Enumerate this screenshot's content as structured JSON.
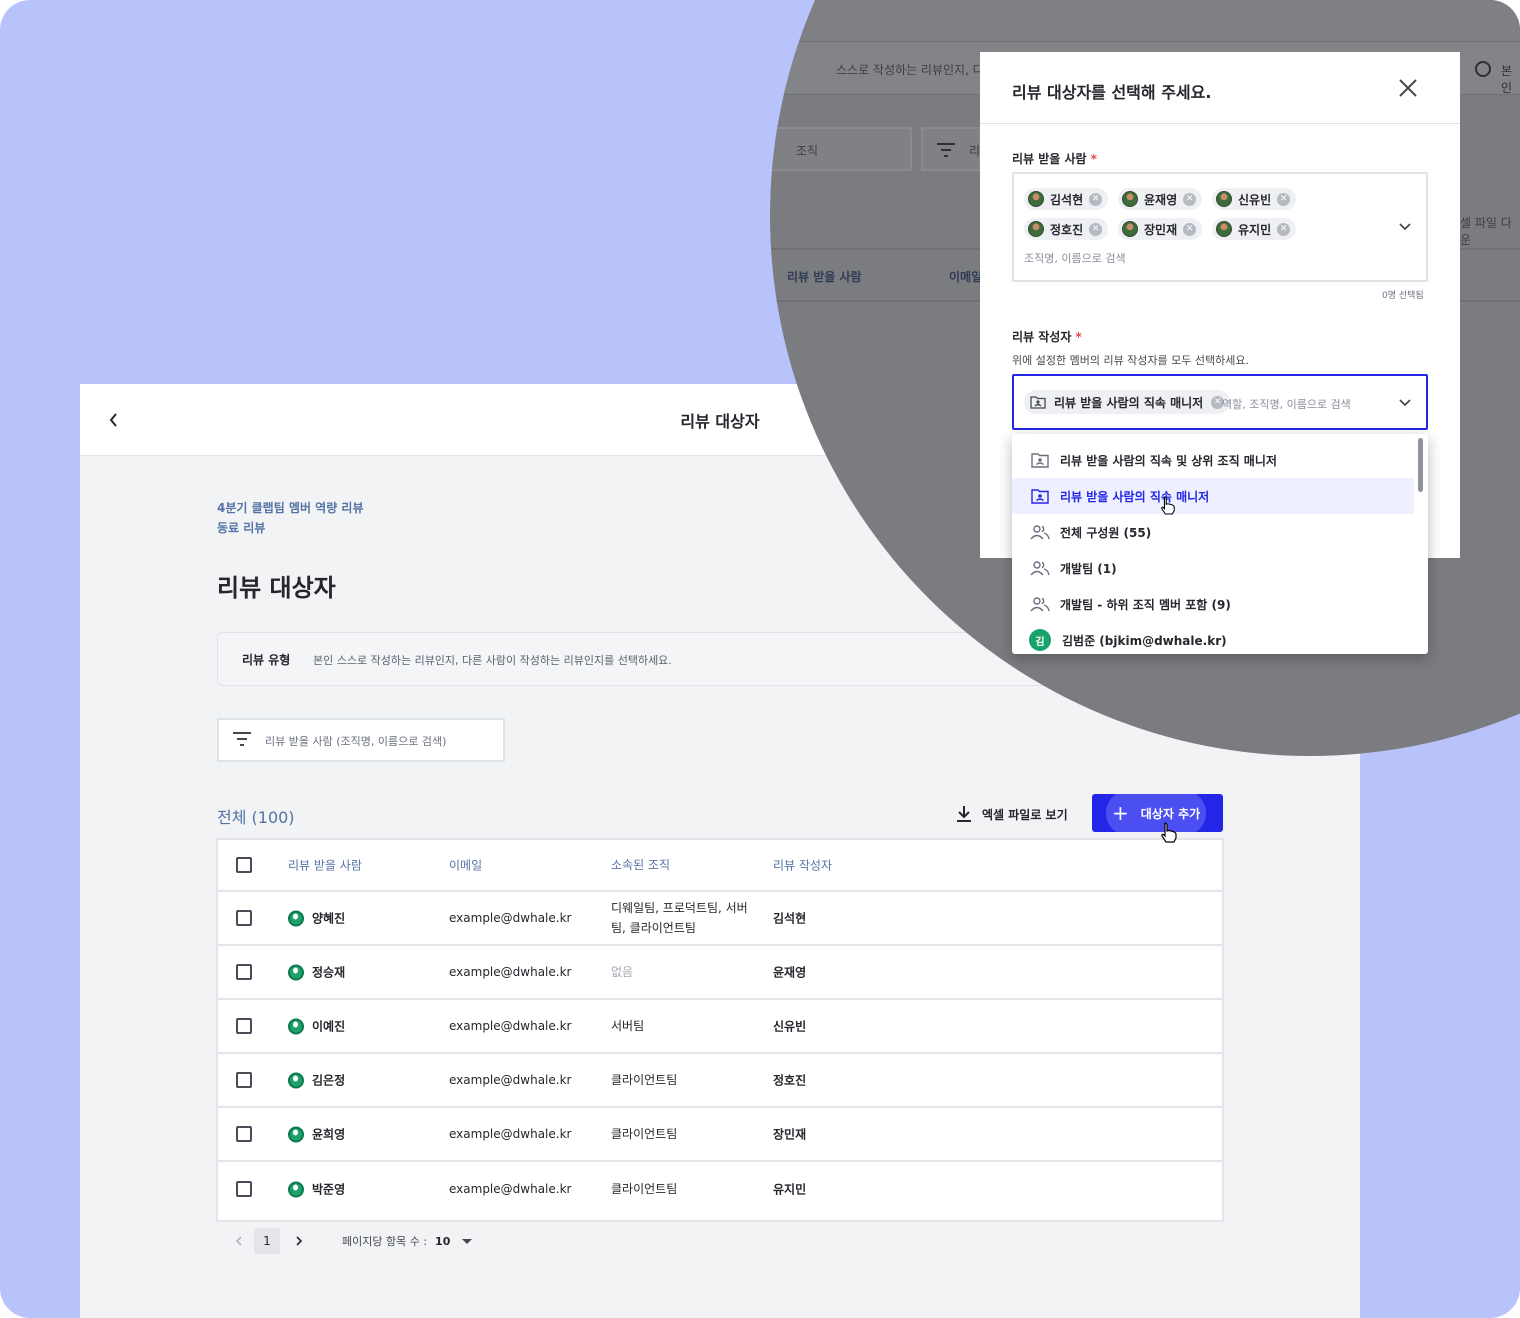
{
  "app": {
    "title": "리뷰 대상자",
    "breadcrumb": [
      "4분기 클랩팀 멤버 역량 리뷰",
      "동료 리뷰"
    ],
    "page_title": "리뷰 대상자",
    "review_type": {
      "label": "리뷰 유형",
      "description": "본인 스스로 작성하는 리뷰인지, 다른 사람이 작성하는 리뷰인지를 선택하세요."
    },
    "filter": {
      "placeholder": "리뷰 받을 사람 (조직명, 이름으로 검색)"
    },
    "total_label": "전체 (100)",
    "excel_label": "엑셀 파일로 보기",
    "add_label": "대상자 추가",
    "table": {
      "headers": [
        "리뷰 받을 사람",
        "이메일",
        "소속된 조직",
        "리뷰 작성자"
      ],
      "rows": [
        {
          "name": "양혜진",
          "email": "example@dwhale.kr",
          "org": "디웨일팀, 프로덕트팀, 서버팀, 클라이언트팀",
          "writer": "김석현"
        },
        {
          "name": "정승재",
          "email": "example@dwhale.kr",
          "org": "없음",
          "writer": "윤재영"
        },
        {
          "name": "이예진",
          "email": "example@dwhale.kr",
          "org": "서버팀",
          "writer": "신유빈"
        },
        {
          "name": "김은정",
          "email": "example@dwhale.kr",
          "org": "클라이언트팀",
          "writer": "정호진"
        },
        {
          "name": "윤희영",
          "email": "example@dwhale.kr",
          "org": "클라이언트팀",
          "writer": "장민재"
        },
        {
          "name": "박준영",
          "email": "example@dwhale.kr",
          "org": "클라이언트팀",
          "writer": "유지민"
        }
      ]
    },
    "pagination": {
      "current_page": "1",
      "per_page_label": "페이지당 항목 수 :",
      "per_page_value": "10"
    }
  },
  "background": {
    "type_strip_text": "스스로 작성하는 리뷰인지, 다",
    "radio_label": "본인",
    "search1": "조직",
    "search2": "리",
    "excel": "셀 파일 다운",
    "headers": [
      "리뷰 받을 사람",
      "이메일"
    ]
  },
  "modal": {
    "title": "리뷰 대상자를 선택해 주세요.",
    "receivers": {
      "label": "리뷰 받을 사람",
      "required_mark": "*",
      "chips": [
        "김석현",
        "윤재영",
        "신유빈",
        "정호진",
        "장민재",
        "유지민"
      ],
      "placeholder": "조직명, 이름으로 검색",
      "count": "0명 선택됨"
    },
    "writers": {
      "label": "리뷰 작성자",
      "required_mark": "*",
      "description": "위에 설정한 멤버의 리뷰 작성자를 모두 선택하세요.",
      "chip": "리뷰 받을 사람의 직속 매니저",
      "placeholder": "역할, 조직명, 이름으로 검색"
    },
    "dropdown": [
      {
        "label": "리뷰 받을 사람의 직속 및 상위 조직 매니저",
        "icon": "manager-folder-icon"
      },
      {
        "label": "리뷰 받을 사람의 직속 매니저",
        "icon": "manager-folder-icon",
        "active": true
      },
      {
        "label": "전체 구성원 (55)",
        "icon": "group-icon"
      },
      {
        "label": "개발팀 (1)",
        "icon": "group-icon"
      },
      {
        "label": "개발팀 - 하위 조직 멤버 포함 (9)",
        "icon": "group-icon"
      },
      {
        "label": "김범준 (bjkim@dwhale.kr)",
        "icon": "avatar",
        "avatar_text": "김"
      }
    ]
  },
  "colors": {
    "accent": "#2326e6",
    "link": "#5473a6",
    "background": "#b8c3fc"
  }
}
